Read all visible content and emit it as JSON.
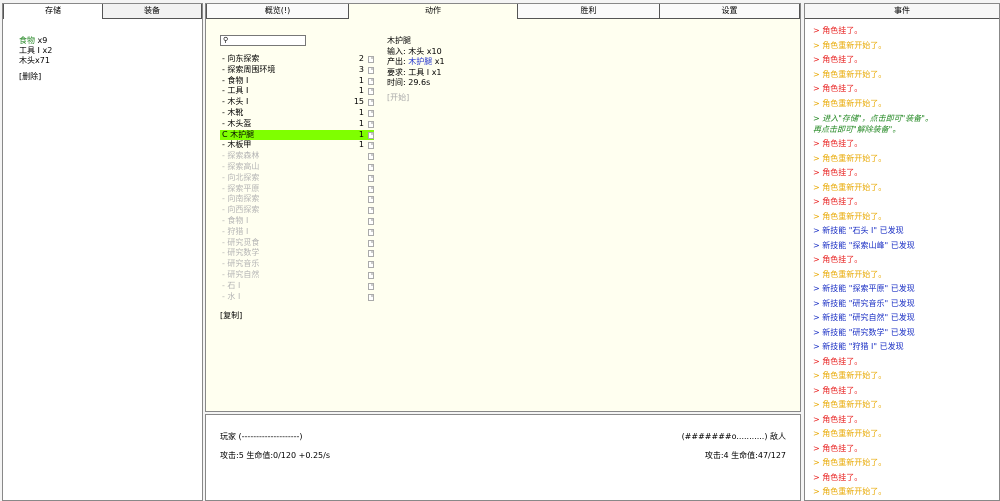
{
  "left": {
    "tabs": [
      "存储",
      "装备"
    ],
    "inventory": [
      {
        "name": "食物",
        "qty": "x9"
      },
      {
        "name": "工具 I",
        "qty": "x2"
      },
      {
        "name": "木头",
        "qty": "x71"
      }
    ],
    "delete_label": "[删除]"
  },
  "center": {
    "tabs": [
      "概览(!)",
      "动作",
      "胜利",
      "设置"
    ],
    "search_placeholder": "",
    "actions": [
      {
        "label": "- 向东探索",
        "count": "2",
        "state": "enabled"
      },
      {
        "label": "- 探索周围环境",
        "count": "3",
        "state": "enabled"
      },
      {
        "label": "- 食物 I",
        "count": "1",
        "state": "enabled"
      },
      {
        "label": "- 工具 I",
        "count": "1",
        "state": "enabled"
      },
      {
        "label": "- 木头 I",
        "count": "15",
        "state": "enabled"
      },
      {
        "label": "- 木靴",
        "count": "1",
        "state": "enabled"
      },
      {
        "label": "- 木头盔",
        "count": "1",
        "state": "enabled"
      },
      {
        "label": "C 木护腿",
        "count": "1",
        "state": "selected"
      },
      {
        "label": "- 木板甲",
        "count": "1",
        "state": "enabled"
      },
      {
        "label": "- 探索森林",
        "count": "",
        "state": "disabled"
      },
      {
        "label": "- 探索高山",
        "count": "",
        "state": "disabled"
      },
      {
        "label": "- 向北探索",
        "count": "",
        "state": "disabled"
      },
      {
        "label": "- 探索平原",
        "count": "",
        "state": "disabled"
      },
      {
        "label": "- 向南探索",
        "count": "",
        "state": "disabled"
      },
      {
        "label": "- 向西探索",
        "count": "",
        "state": "disabled"
      },
      {
        "label": "- 食物 I",
        "count": "",
        "state": "disabled"
      },
      {
        "label": "- 狩猎 I",
        "count": "",
        "state": "disabled"
      },
      {
        "label": "- 研究觅食",
        "count": "",
        "state": "disabled"
      },
      {
        "label": "- 研究数学",
        "count": "",
        "state": "disabled"
      },
      {
        "label": "- 研究音乐",
        "count": "",
        "state": "disabled"
      },
      {
        "label": "- 研究自然",
        "count": "",
        "state": "disabled"
      },
      {
        "label": "- 石 I",
        "count": "",
        "state": "disabled"
      },
      {
        "label": "- 水 I",
        "count": "",
        "state": "disabled"
      }
    ],
    "copy_label": "[复制]",
    "detail": {
      "title": "木护腿",
      "input_label": "输入:",
      "input_value": "木头 x10",
      "output_label": "产出:",
      "output_item": "木护腿",
      "output_qty": "x1",
      "require_label": "要求:",
      "require_value": "工具 I x1",
      "time_label": "时间:",
      "time_value": "29.6s",
      "start_label": "[开始]"
    }
  },
  "bottom": {
    "player_label": "玩家 (--------------------)",
    "enemy_label": "(#######o...........) 敌人",
    "player_stats": "攻击:5 生命值:0/120 +0.25/s",
    "enemy_stats": "攻击:4 生命值:47/127"
  },
  "right": {
    "title": "事件",
    "events": [
      {
        "text": "> 角色挂了。",
        "kind": "red"
      },
      {
        "text": "> 角色重新开始了。",
        "kind": "orange"
      },
      {
        "text": "> 角色挂了。",
        "kind": "red"
      },
      {
        "text": "> 角色重新开始了。",
        "kind": "orange"
      },
      {
        "text": "> 角色挂了。",
        "kind": "red"
      },
      {
        "text": "> 角色重新开始了。",
        "kind": "orange"
      },
      {
        "text": "> 进入\"存储\"，点击即可\"装备\"。",
        "text2": "再点击即可\"解除装备\"。",
        "kind": "green"
      },
      {
        "text": "> 角色挂了。",
        "kind": "red"
      },
      {
        "text": "> 角色重新开始了。",
        "kind": "orange"
      },
      {
        "text": "> 角色挂了。",
        "kind": "red"
      },
      {
        "text": "> 角色重新开始了。",
        "kind": "orange"
      },
      {
        "text": "> 角色挂了。",
        "kind": "red"
      },
      {
        "text": "> 角色重新开始了。",
        "kind": "orange"
      },
      {
        "text": "> 新技能 \"石头 I\" 已发现",
        "kind": "blue"
      },
      {
        "text": "> 新技能 \"探索山峰\" 已发现",
        "kind": "blue"
      },
      {
        "text": "> 角色挂了。",
        "kind": "red"
      },
      {
        "text": "> 角色重新开始了。",
        "kind": "orange"
      },
      {
        "text": "> 新技能 \"探索平原\" 已发现",
        "kind": "blue"
      },
      {
        "text": "> 新技能 \"研究音乐\" 已发现",
        "kind": "blue"
      },
      {
        "text": "> 新技能 \"研究自然\" 已发现",
        "kind": "blue"
      },
      {
        "text": "> 新技能 \"研究数学\" 已发现",
        "kind": "blue"
      },
      {
        "text": "> 新技能 \"狩猎 I\" 已发现",
        "kind": "blue"
      },
      {
        "text": "> 角色挂了。",
        "kind": "red"
      },
      {
        "text": "> 角色重新开始了。",
        "kind": "orange"
      },
      {
        "text": "> 角色挂了。",
        "kind": "red"
      },
      {
        "text": "> 角色重新开始了。",
        "kind": "orange"
      },
      {
        "text": "> 角色挂了。",
        "kind": "red"
      },
      {
        "text": "> 角色重新开始了。",
        "kind": "orange"
      },
      {
        "text": "> 角色挂了。",
        "kind": "red"
      },
      {
        "text": "> 角色重新开始了。",
        "kind": "orange"
      },
      {
        "text": "> 角色挂了。",
        "kind": "red"
      },
      {
        "text": "> 角色重新开始了。",
        "kind": "orange"
      }
    ]
  },
  "colors": {
    "selected": "#7fff00",
    "event_red": "#e8201f",
    "event_orange": "#e8a800",
    "event_blue": "#1a2fc4",
    "event_green": "#228822"
  }
}
